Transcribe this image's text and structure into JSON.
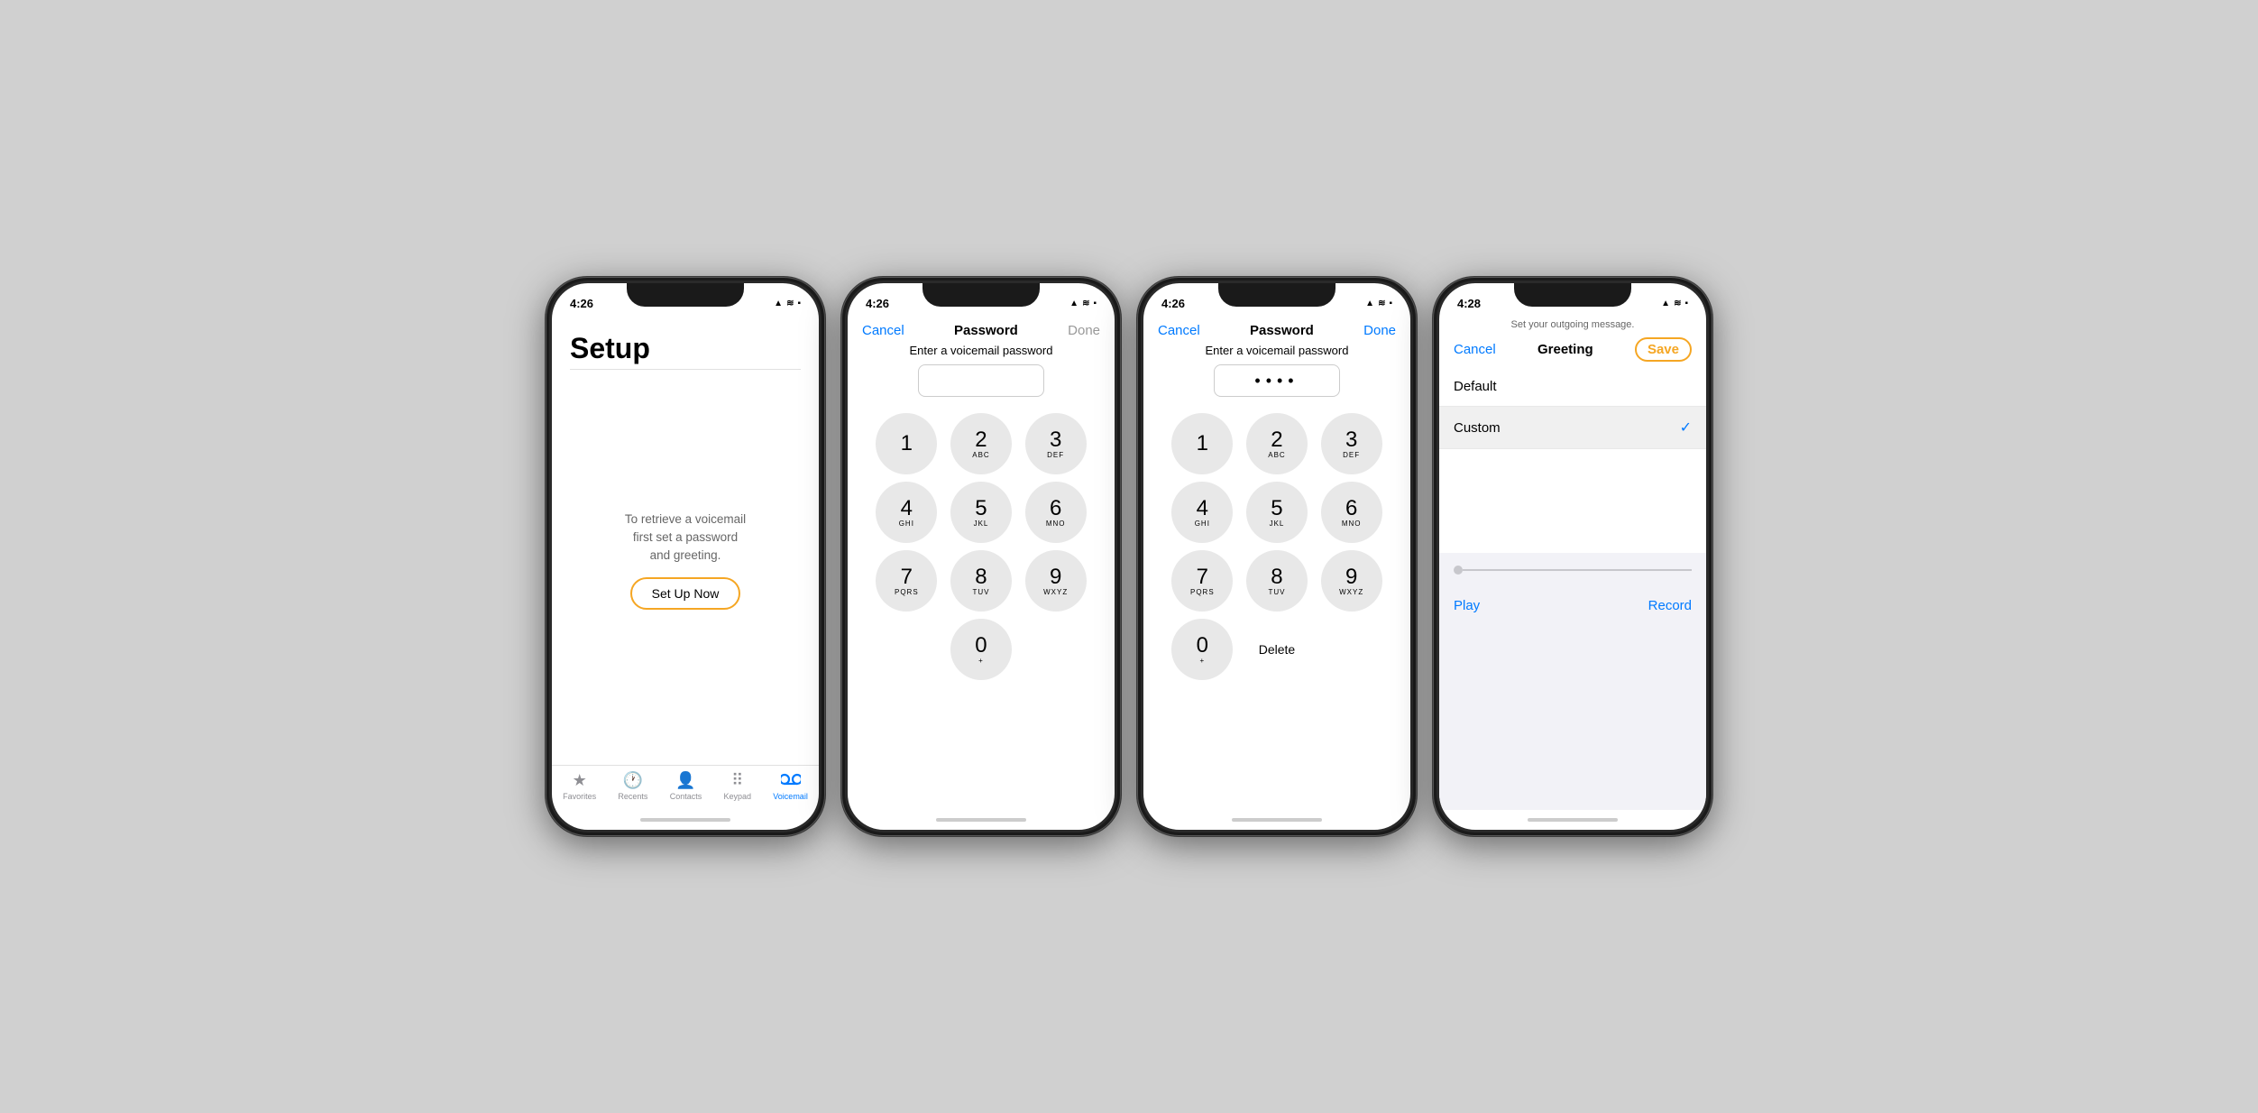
{
  "phone1": {
    "statusTime": "4:26",
    "statusIcons": "▲ .lll ⊃ ▪",
    "title": "Setup",
    "divider": true,
    "bodyText": "To retrieve a voicemail\nfirst set a password\nand greeting.",
    "setupBtn": "Set Up Now",
    "tabs": [
      {
        "label": "Favorites",
        "icon": "★",
        "active": false
      },
      {
        "label": "Recents",
        "icon": "🕐",
        "active": false
      },
      {
        "label": "Contacts",
        "icon": "👤",
        "active": false
      },
      {
        "label": "Keypad",
        "icon": "⠿",
        "active": false
      },
      {
        "label": "Voicemail",
        "icon": "∞",
        "active": true
      }
    ]
  },
  "phone2": {
    "statusTime": "4:26",
    "navCancel": "Cancel",
    "navTitle": "Password",
    "navDone": "Done",
    "navDoneDim": true,
    "pwLabel": "Enter a voicemail password",
    "pwValue": "",
    "keys": [
      {
        "main": "1",
        "sub": ""
      },
      {
        "main": "2",
        "sub": "ABC"
      },
      {
        "main": "3",
        "sub": "DEF"
      },
      {
        "main": "4",
        "sub": "GHI"
      },
      {
        "main": "5",
        "sub": "JKL"
      },
      {
        "main": "6",
        "sub": "MNO"
      },
      {
        "main": "7",
        "sub": "PQRS"
      },
      {
        "main": "8",
        "sub": "TUV"
      },
      {
        "main": "9",
        "sub": "WXYZ"
      },
      {
        "main": "0",
        "sub": "+"
      }
    ]
  },
  "phone3": {
    "statusTime": "4:26",
    "navCancel": "Cancel",
    "navTitle": "Password",
    "navDone": "Done",
    "navDoneDim": false,
    "pwLabel": "Enter a voicemail password",
    "pwValue": "••••",
    "deleteLabel": "Delete",
    "keys": [
      {
        "main": "1",
        "sub": ""
      },
      {
        "main": "2",
        "sub": "ABC"
      },
      {
        "main": "3",
        "sub": "DEF"
      },
      {
        "main": "4",
        "sub": "GHI"
      },
      {
        "main": "5",
        "sub": "JKL"
      },
      {
        "main": "6",
        "sub": "MNO"
      },
      {
        "main": "7",
        "sub": "PQRS"
      },
      {
        "main": "8",
        "sub": "TUV"
      },
      {
        "main": "9",
        "sub": "WXYZ"
      },
      {
        "main": "0",
        "sub": "+"
      }
    ]
  },
  "phone4": {
    "statusTime": "4:28",
    "navCancel": "Cancel",
    "navTitle": "Greeting",
    "navSave": "Save",
    "subNote": "Set your outgoing message.",
    "defaultLabel": "Default",
    "customLabel": "Custom",
    "playLabel": "Play",
    "recordLabel": "Record"
  }
}
